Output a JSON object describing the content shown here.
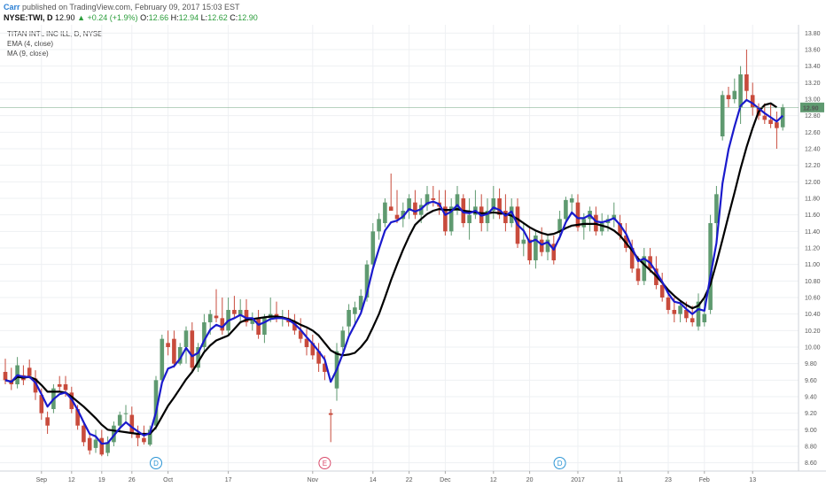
{
  "header": {
    "author": "Carr",
    "published": "published on TradingView.com, February 09, 2017 15:03 EST",
    "symbol": "NYSE:TWI, D",
    "last": "12.90",
    "change": "+0.24 (+1.9%)",
    "open_label": "O:",
    "open": "12.66",
    "high_label": "H:",
    "high": "12.94",
    "low_label": "L:",
    "low": "12.62",
    "close_label": "C:",
    "close": "12.90"
  },
  "legend": {
    "title": "TITAN INTL INC ILL, D, NYSE",
    "ema": "EMA (4, close)",
    "ma": "MA (9, close)"
  },
  "colors": {
    "up": "#5f9a70",
    "down": "#c84b3c",
    "ema": "#1a1acc",
    "ma": "#000000",
    "price_tag": "#5f9a70",
    "event_d": "#2a94d4",
    "event_e": "#d94a6a",
    "grid": "#eef0f3"
  },
  "chart_data": {
    "type": "candlestick",
    "ylim": [
      8.5,
      13.9
    ],
    "grid": true,
    "y_ticks": [
      "8.60",
      "8.80",
      "9.00",
      "9.20",
      "9.40",
      "9.60",
      "9.80",
      "10.00",
      "10.20",
      "10.40",
      "10.60",
      "10.80",
      "11.00",
      "11.20",
      "11.40",
      "11.60",
      "11.80",
      "12.00",
      "12.20",
      "12.40",
      "12.60",
      "12.80",
      "13.00",
      "13.20",
      "13.40",
      "13.60",
      "13.80"
    ],
    "x_ticks": [
      "Sep",
      "12",
      "19",
      "26",
      "Oct",
      "17",
      "Nov",
      "14",
      "22",
      "Dec",
      "12",
      "20",
      "2017",
      "11",
      "23",
      "Feb",
      "13"
    ],
    "x_tick_bars": [
      6,
      11,
      16,
      21,
      27,
      37,
      51,
      61,
      67,
      73,
      81,
      87,
      95,
      102,
      110,
      116,
      124
    ],
    "current_price": "12.90",
    "events": [
      {
        "label": "D",
        "bar": 25
      },
      {
        "label": "E",
        "bar": 53
      },
      {
        "label": "D",
        "bar": 92
      }
    ],
    "candles": [
      [
        9.7,
        9.86,
        9.55,
        9.6
      ],
      [
        9.6,
        9.75,
        9.48,
        9.55
      ],
      [
        9.55,
        9.88,
        9.5,
        9.78
      ],
      [
        9.66,
        9.78,
        9.54,
        9.6
      ],
      [
        9.75,
        9.85,
        9.62,
        9.65
      ],
      [
        9.62,
        9.72,
        9.36,
        9.45
      ],
      [
        9.42,
        9.5,
        9.12,
        9.2
      ],
      [
        9.15,
        9.22,
        8.95,
        9.05
      ],
      [
        9.25,
        9.55,
        9.2,
        9.5
      ],
      [
        9.55,
        9.65,
        9.45,
        9.52
      ],
      [
        9.55,
        9.65,
        9.4,
        9.48
      ],
      [
        9.45,
        9.52,
        9.2,
        9.25
      ],
      [
        9.25,
        9.3,
        9.0,
        9.05
      ],
      [
        9.05,
        9.1,
        8.8,
        8.85
      ],
      [
        8.9,
        8.95,
        8.7,
        8.75
      ],
      [
        8.78,
        9.0,
        8.72,
        8.88
      ],
      [
        8.9,
        9.0,
        8.68,
        8.7
      ],
      [
        8.72,
        8.92,
        8.68,
        8.85
      ],
      [
        8.85,
        9.1,
        8.8,
        9.05
      ],
      [
        9.05,
        9.22,
        8.98,
        9.18
      ],
      [
        9.2,
        9.3,
        9.1,
        9.2
      ],
      [
        9.18,
        9.28,
        8.9,
        8.95
      ],
      [
        8.95,
        9.05,
        8.8,
        8.9
      ],
      [
        8.9,
        9.05,
        8.82,
        8.85
      ],
      [
        8.82,
        9.05,
        8.8,
        9.0
      ],
      [
        9.05,
        9.65,
        9.0,
        9.6
      ],
      [
        9.6,
        10.15,
        9.55,
        10.1
      ],
      [
        10.05,
        10.2,
        9.9,
        10.0
      ],
      [
        10.1,
        10.2,
        9.75,
        9.8
      ],
      [
        9.8,
        10.05,
        9.78,
        10.0
      ],
      [
        10.0,
        10.25,
        9.8,
        10.2
      ],
      [
        10.2,
        10.3,
        9.7,
        9.75
      ],
      [
        9.75,
        10.05,
        9.7,
        10.0
      ],
      [
        10.0,
        10.4,
        9.95,
        10.3
      ],
      [
        10.3,
        10.45,
        10.15,
        10.4
      ],
      [
        10.38,
        10.7,
        10.3,
        10.35
      ],
      [
        10.35,
        10.6,
        10.15,
        10.2
      ],
      [
        10.2,
        10.6,
        10.15,
        10.45
      ],
      [
        10.45,
        10.62,
        10.35,
        10.4
      ],
      [
        10.38,
        10.58,
        10.3,
        10.45
      ],
      [
        10.45,
        10.58,
        10.25,
        10.3
      ],
      [
        10.28,
        10.42,
        10.2,
        10.35
      ],
      [
        10.35,
        10.45,
        10.1,
        10.15
      ],
      [
        10.15,
        10.4,
        10.05,
        10.35
      ],
      [
        10.35,
        10.6,
        10.3,
        10.4
      ],
      [
        10.4,
        10.55,
        10.3,
        10.35
      ],
      [
        10.35,
        10.45,
        10.25,
        10.35
      ],
      [
        10.35,
        10.45,
        10.25,
        10.3
      ],
      [
        10.3,
        10.4,
        10.15,
        10.2
      ],
      [
        10.2,
        10.35,
        10.05,
        10.1
      ],
      [
        10.1,
        10.22,
        9.9,
        10.0
      ],
      [
        10.05,
        10.15,
        9.85,
        9.9
      ],
      [
        9.95,
        10.05,
        9.7,
        9.8
      ],
      [
        9.8,
        9.9,
        9.6,
        9.7
      ],
      [
        9.2,
        9.25,
        8.85,
        9.18
      ],
      [
        9.5,
        10.05,
        9.35,
        9.95
      ],
      [
        10.0,
        10.25,
        9.95,
        10.2
      ],
      [
        10.25,
        10.52,
        10.15,
        10.45
      ],
      [
        10.4,
        10.55,
        10.25,
        10.48
      ],
      [
        10.45,
        10.7,
        10.4,
        10.62
      ],
      [
        10.6,
        11.05,
        10.55,
        11.0
      ],
      [
        11.0,
        11.5,
        10.95,
        11.4
      ],
      [
        11.4,
        11.62,
        11.3,
        11.55
      ],
      [
        11.5,
        11.8,
        11.45,
        11.75
      ],
      [
        11.7,
        12.1,
        11.65,
        11.65
      ],
      [
        11.6,
        11.9,
        11.5,
        11.55
      ],
      [
        11.55,
        11.75,
        11.45,
        11.65
      ],
      [
        11.65,
        11.85,
        11.55,
        11.8
      ],
      [
        11.75,
        11.9,
        11.55,
        11.6
      ],
      [
        11.6,
        11.8,
        11.5,
        11.72
      ],
      [
        11.72,
        11.95,
        11.65,
        11.85
      ],
      [
        11.8,
        11.95,
        11.7,
        11.78
      ],
      [
        11.75,
        11.9,
        11.6,
        11.7
      ],
      [
        11.7,
        11.9,
        11.35,
        11.4
      ],
      [
        11.4,
        11.8,
        11.35,
        11.7
      ],
      [
        11.65,
        11.95,
        11.6,
        11.85
      ],
      [
        11.8,
        11.85,
        11.45,
        11.5
      ],
      [
        11.5,
        11.8,
        11.3,
        11.6
      ],
      [
        11.6,
        11.9,
        11.55,
        11.7
      ],
      [
        11.7,
        11.85,
        11.4,
        11.5
      ],
      [
        11.5,
        11.8,
        11.4,
        11.65
      ],
      [
        11.65,
        11.95,
        11.55,
        11.8
      ],
      [
        11.8,
        11.92,
        11.55,
        11.6
      ],
      [
        11.65,
        11.85,
        11.4,
        11.5
      ],
      [
        11.5,
        11.8,
        11.45,
        11.7
      ],
      [
        11.7,
        11.8,
        11.2,
        11.25
      ],
      [
        11.25,
        11.5,
        11.1,
        11.3
      ],
      [
        11.3,
        11.45,
        11.0,
        11.05
      ],
      [
        11.05,
        11.4,
        10.95,
        11.35
      ],
      [
        11.3,
        11.45,
        11.1,
        11.15
      ],
      [
        11.15,
        11.35,
        11.05,
        11.3
      ],
      [
        11.25,
        11.35,
        11.0,
        11.05
      ],
      [
        11.4,
        11.65,
        11.3,
        11.55
      ],
      [
        11.55,
        11.82,
        11.5,
        11.78
      ],
      [
        11.75,
        11.85,
        11.6,
        11.8
      ],
      [
        11.75,
        11.85,
        11.4,
        11.45
      ],
      [
        11.45,
        11.62,
        11.3,
        11.55
      ],
      [
        11.55,
        11.7,
        11.4,
        11.65
      ],
      [
        11.6,
        11.7,
        11.35,
        11.4
      ],
      [
        11.4,
        11.62,
        11.35,
        11.5
      ],
      [
        11.5,
        11.6,
        11.4,
        11.55
      ],
      [
        11.55,
        11.75,
        11.45,
        11.6
      ],
      [
        11.5,
        11.6,
        11.3,
        11.35
      ],
      [
        11.35,
        11.5,
        11.15,
        11.2
      ],
      [
        11.2,
        11.3,
        10.9,
        10.95
      ],
      [
        10.95,
        11.1,
        10.75,
        10.8
      ],
      [
        10.8,
        11.2,
        10.75,
        11.1
      ],
      [
        11.1,
        11.2,
        10.9,
        10.95
      ],
      [
        10.95,
        11.1,
        10.7,
        10.75
      ],
      [
        10.75,
        10.9,
        10.55,
        10.6
      ],
      [
        10.6,
        10.7,
        10.4,
        10.45
      ],
      [
        10.45,
        10.6,
        10.3,
        10.4
      ],
      [
        10.4,
        10.55,
        10.3,
        10.5
      ],
      [
        10.45,
        10.55,
        10.3,
        10.35
      ],
      [
        10.35,
        10.5,
        10.25,
        10.3
      ],
      [
        10.25,
        10.65,
        10.2,
        10.55
      ],
      [
        10.3,
        10.6,
        10.25,
        10.4
      ],
      [
        10.45,
        11.6,
        10.4,
        11.5
      ],
      [
        11.5,
        11.95,
        11.3,
        11.85
      ],
      [
        12.55,
        13.1,
        12.5,
        13.05
      ],
      [
        13.05,
        13.15,
        12.9,
        13.0
      ],
      [
        13.0,
        13.25,
        12.95,
        13.1
      ],
      [
        12.9,
        13.4,
        12.7,
        13.3
      ],
      [
        13.3,
        13.6,
        13.0,
        13.1
      ],
      [
        13.05,
        13.2,
        12.8,
        12.9
      ],
      [
        12.9,
        12.95,
        12.75,
        12.8
      ],
      [
        12.8,
        12.95,
        12.7,
        12.75
      ],
      [
        12.75,
        12.95,
        12.65,
        12.7
      ],
      [
        12.72,
        12.85,
        12.4,
        12.65
      ],
      [
        12.66,
        12.94,
        12.62,
        12.9
      ]
    ],
    "ema_4": [
      9.6,
      9.58,
      9.66,
      9.64,
      9.64,
      9.57,
      9.43,
      9.28,
      9.37,
      9.43,
      9.45,
      9.37,
      9.24,
      9.09,
      8.95,
      8.92,
      8.83,
      8.84,
      8.93,
      9.02,
      9.09,
      9.03,
      8.98,
      8.93,
      8.96,
      9.21,
      9.57,
      9.74,
      9.77,
      9.86,
      9.99,
      9.89,
      9.93,
      10.08,
      10.21,
      10.27,
      10.24,
      10.32,
      10.35,
      10.39,
      10.35,
      10.35,
      10.27,
      10.3,
      10.34,
      10.35,
      10.35,
      10.33,
      10.28,
      10.21,
      10.12,
      10.04,
      9.95,
      9.85,
      9.58,
      9.73,
      9.92,
      10.13,
      10.27,
      10.41,
      10.65,
      10.95,
      11.19,
      11.41,
      11.51,
      11.53,
      11.58,
      11.67,
      11.64,
      11.67,
      11.74,
      11.76,
      11.73,
      11.6,
      11.64,
      11.72,
      11.63,
      11.62,
      11.65,
      11.59,
      11.61,
      11.69,
      11.66,
      11.59,
      11.64,
      11.48,
      11.41,
      11.27,
      11.3,
      11.24,
      11.27,
      11.18,
      11.33,
      11.51,
      11.63,
      11.56,
      11.56,
      11.6,
      11.52,
      11.51,
      11.53,
      11.56,
      11.48,
      11.37,
      11.2,
      11.04,
      11.07,
      11.02,
      10.91,
      10.79,
      10.65,
      10.55,
      10.53,
      10.46,
      10.4,
      10.46,
      10.44,
      10.86,
      11.26,
      11.98,
      12.39,
      12.67,
      12.92,
      12.99,
      12.95,
      12.89,
      12.83,
      12.78,
      12.73,
      12.8
    ],
    "ma_9": [
      9.6,
      9.58,
      9.64,
      9.63,
      9.64,
      9.61,
      9.54,
      9.46,
      9.46,
      9.46,
      9.45,
      9.4,
      9.34,
      9.28,
      9.21,
      9.14,
      9.06,
      9.0,
      8.99,
      8.98,
      8.97,
      8.96,
      8.95,
      8.95,
      8.95,
      9.03,
      9.16,
      9.29,
      9.39,
      9.5,
      9.61,
      9.7,
      9.82,
      9.94,
      10.02,
      10.08,
      10.11,
      10.14,
      10.22,
      10.3,
      10.33,
      10.34,
      10.35,
      10.36,
      10.37,
      10.37,
      10.36,
      10.34,
      10.31,
      10.27,
      10.24,
      10.2,
      10.14,
      10.05,
      9.96,
      9.92,
      9.9,
      9.91,
      9.93,
      10.0,
      10.09,
      10.24,
      10.4,
      10.6,
      10.81,
      11.0,
      11.18,
      11.34,
      11.48,
      11.55,
      11.61,
      11.65,
      11.67,
      11.66,
      11.66,
      11.67,
      11.65,
      11.64,
      11.63,
      11.62,
      11.62,
      11.63,
      11.62,
      11.61,
      11.59,
      11.55,
      11.5,
      11.45,
      11.41,
      11.38,
      11.36,
      11.37,
      11.4,
      11.44,
      11.47,
      11.48,
      11.49,
      11.49,
      11.49,
      11.47,
      11.45,
      11.41,
      11.35,
      11.26,
      11.17,
      11.07,
      11.0,
      10.93,
      10.86,
      10.78,
      10.69,
      10.62,
      10.56,
      10.51,
      10.47,
      10.5,
      10.6,
      10.76,
      11.02,
      11.3,
      11.59,
      11.87,
      12.16,
      12.42,
      12.65,
      12.85,
      12.93,
      12.95,
      12.9
    ]
  }
}
